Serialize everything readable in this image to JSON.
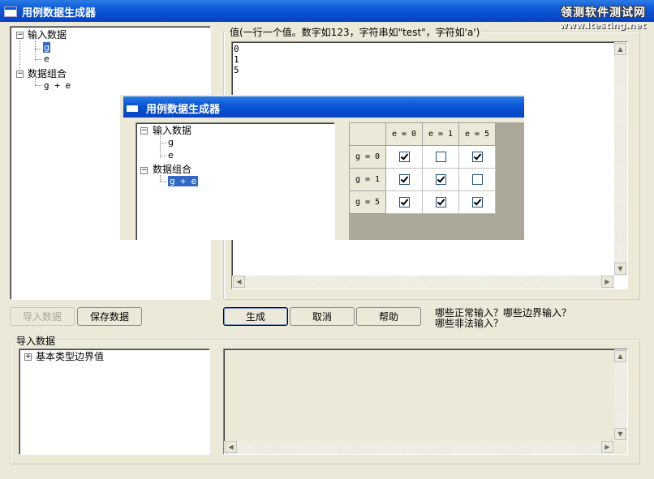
{
  "window": {
    "title": "用例数据生成器"
  },
  "watermark": {
    "line1": "领测软件测试网",
    "line2": "www.ltesting.net"
  },
  "left_tree": {
    "nodes": [
      {
        "label": "输入数据"
      },
      {
        "label": "g"
      },
      {
        "label": "e"
      },
      {
        "label": "数据组合"
      },
      {
        "label": "g + e"
      }
    ]
  },
  "values_group": {
    "label": "值(一行一个值。数字如123，字符串如\"test\"，字符如'a')",
    "lines": [
      "0",
      "1",
      "5"
    ]
  },
  "buttons": {
    "import_data": "导入数据",
    "save_data": "保存数据",
    "generate": "生成",
    "cancel": "取消",
    "help": "帮助"
  },
  "hint": {
    "line1": "哪些正常输入？哪些边界输入？",
    "line2": "哪些非法输入？"
  },
  "import_group": {
    "label": "导入数据",
    "tree_item": "基本类型边界值"
  },
  "inner_window": {
    "title": "用例数据生成器",
    "tree": [
      "输入数据",
      "g",
      "e",
      "数据组合",
      "g + e"
    ],
    "grid": {
      "col_headers": [
        "e = 0",
        "e = 1",
        "e = 5"
      ],
      "rows": [
        {
          "label": "g = 0",
          "checks": [
            true,
            false,
            true
          ]
        },
        {
          "label": "g = 1",
          "checks": [
            true,
            true,
            false
          ]
        },
        {
          "label": "g = 5",
          "checks": [
            true,
            true,
            true
          ]
        }
      ]
    }
  }
}
